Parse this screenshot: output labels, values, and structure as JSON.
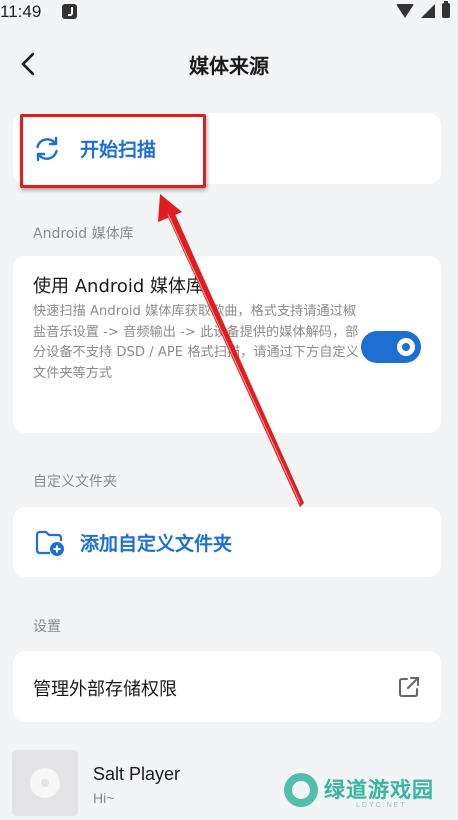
{
  "status_bar": {
    "time": "11:49"
  },
  "header": {
    "title": "媒体来源"
  },
  "scan": {
    "label": "开始扫描"
  },
  "android_section": {
    "heading": "Android 媒体库",
    "title": "使用 Android 媒体库",
    "description": "快速扫描 Android 媒体库获取歌曲，格式支持请通过椒盐音乐设置 -> 音频输出 -> 此设备提供的媒体解码，部分设备不支持 DSD / APE 格式扫描，请通过下方自定义文件夹等方式",
    "toggle_on": true
  },
  "folder_section": {
    "heading": "自定义文件夹",
    "add_label": "添加自定义文件夹"
  },
  "settings_section": {
    "heading": "设置",
    "storage_label": "管理外部存储权限"
  },
  "player": {
    "title": "Salt Player",
    "subtitle": "Hi~"
  },
  "watermark": {
    "text": "绿道游戏园",
    "sub": "LDYC.NET"
  },
  "colors": {
    "accent": "#1d6fd1",
    "background": "#f3f4f6",
    "annotation": "#e21d1d"
  },
  "icons": {
    "back": "back-arrow-icon",
    "scan": "refresh-icon",
    "folder": "folder-add-icon",
    "external": "external-link-icon"
  }
}
